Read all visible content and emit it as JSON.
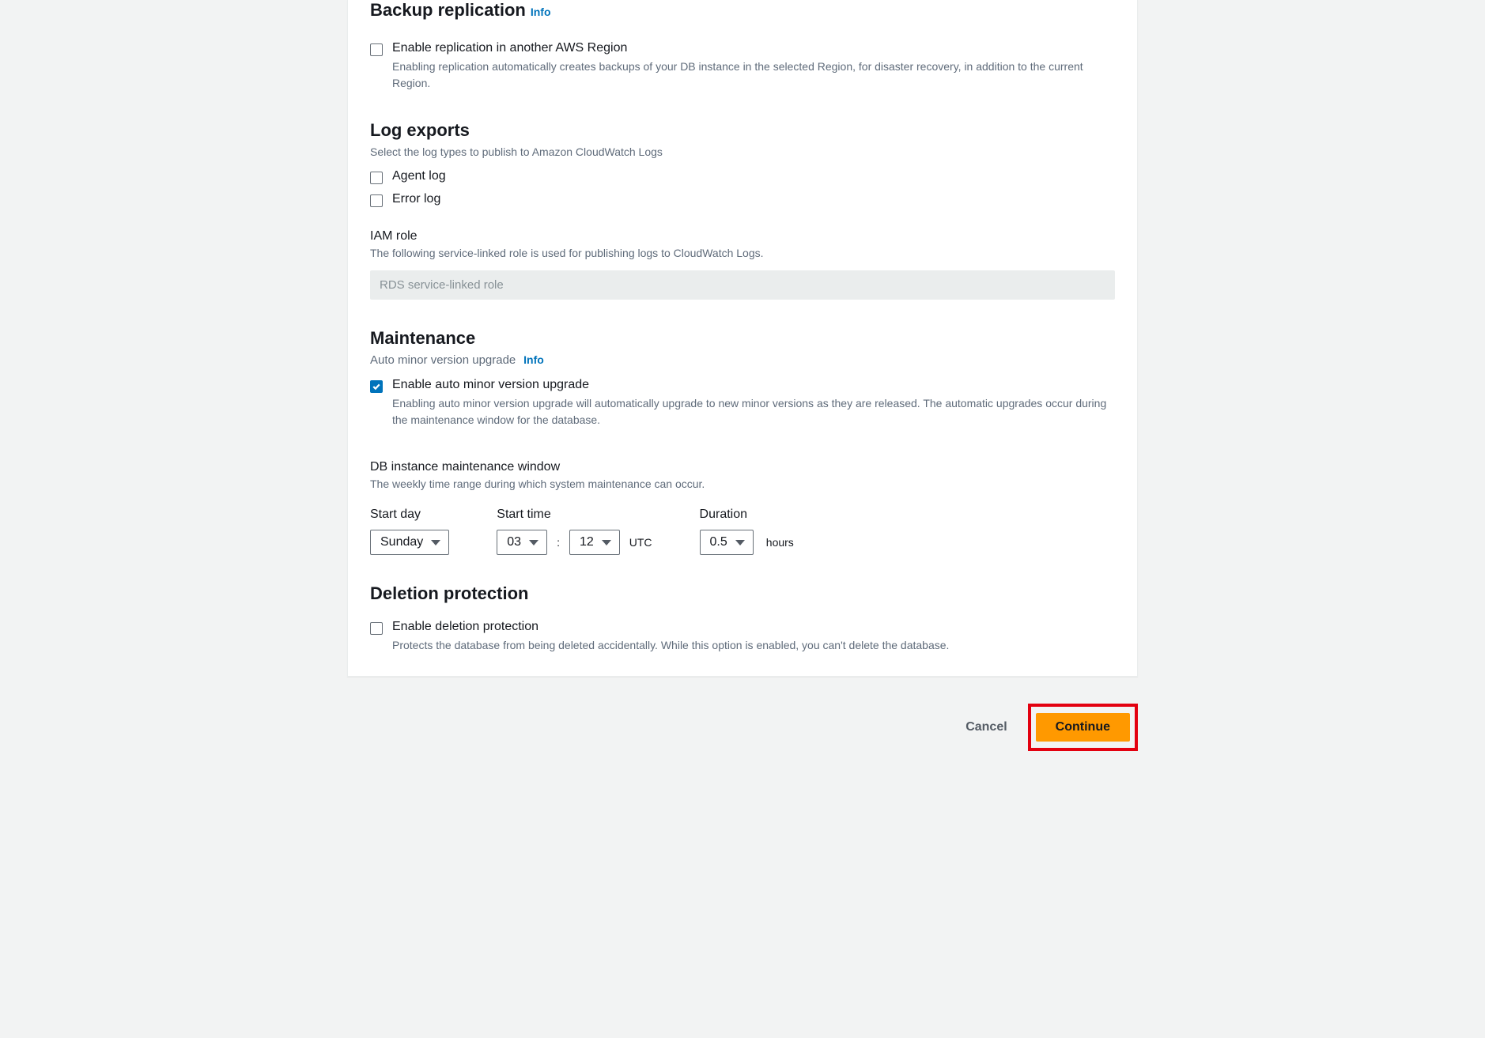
{
  "backup_replication": {
    "title": "Backup replication",
    "info": "Info",
    "checkbox_label": "Enable replication in another AWS Region",
    "checkbox_desc": "Enabling replication automatically creates backups of your DB instance in the selected Region, for disaster recovery, in addition to the current Region.",
    "checked": false
  },
  "log_exports": {
    "title": "Log exports",
    "subtext": "Select the log types to publish to Amazon CloudWatch Logs",
    "options": [
      {
        "label": "Agent log",
        "checked": false
      },
      {
        "label": "Error log",
        "checked": false
      }
    ],
    "iam_role_label": "IAM role",
    "iam_role_desc": "The following service-linked role is used for publishing logs to CloudWatch Logs.",
    "iam_role_value": "RDS service-linked role"
  },
  "maintenance": {
    "title": "Maintenance",
    "auto_minor_label": "Auto minor version upgrade",
    "info": "Info",
    "checkbox_label": "Enable auto minor version upgrade",
    "checkbox_desc": "Enabling auto minor version upgrade will automatically upgrade to new minor versions as they are released. The automatic upgrades occur during the maintenance window for the database.",
    "checked": true,
    "window_label": "DB instance maintenance window",
    "window_desc": "The weekly time range during which system maintenance can occur.",
    "start_day_label": "Start day",
    "start_day_value": "Sunday",
    "start_time_label": "Start time",
    "start_time_hour": "03",
    "start_time_minute": "12",
    "time_separator": ":",
    "tz": "UTC",
    "duration_label": "Duration",
    "duration_value": "0.5",
    "duration_unit": "hours"
  },
  "deletion_protection": {
    "title": "Deletion protection",
    "checkbox_label": "Enable deletion protection",
    "checkbox_desc": "Protects the database from being deleted accidentally. While this option is enabled, you can't delete the database.",
    "checked": false
  },
  "footer": {
    "cancel": "Cancel",
    "continue": "Continue"
  }
}
